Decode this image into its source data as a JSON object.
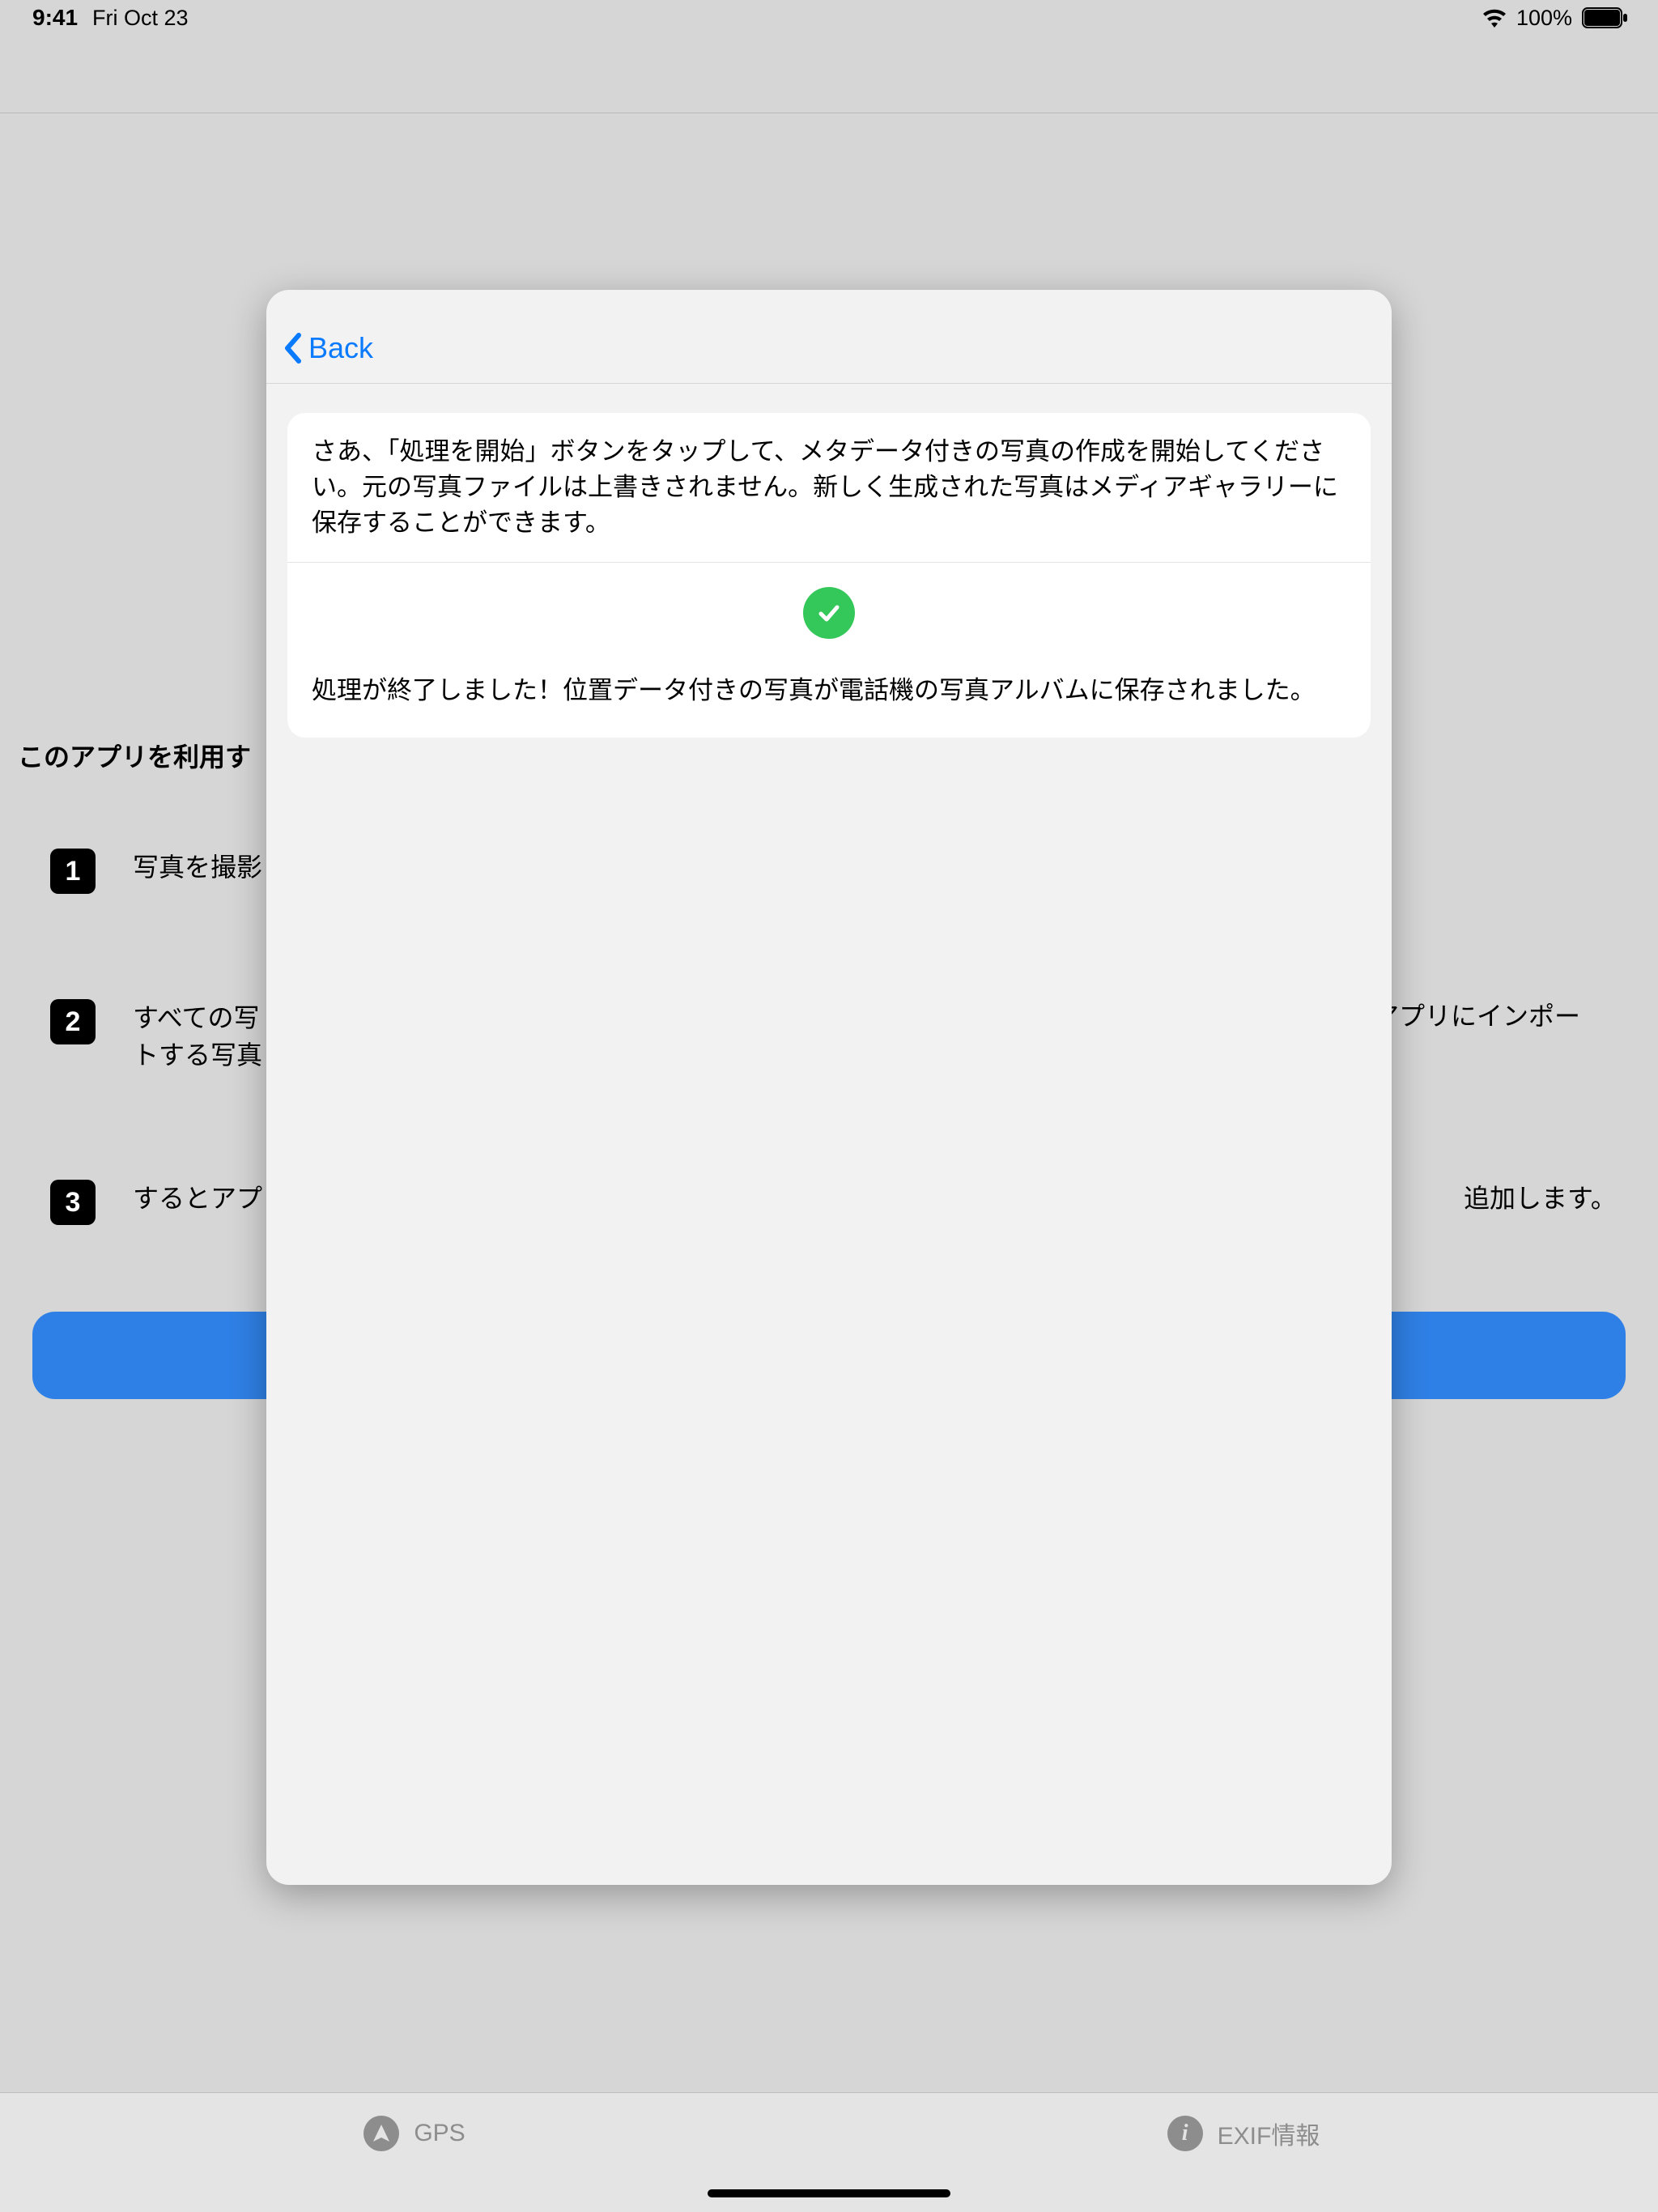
{
  "status_bar": {
    "time": "9:41",
    "date": "Fri Oct 23",
    "battery_pct": "100%"
  },
  "background": {
    "title": "このアプリを利用す",
    "steps": [
      {
        "num": "1",
        "left": "写真を撮影"
      },
      {
        "num": "2",
        "left": "すべての写\nトする写真",
        "right": "アプリにインポー"
      },
      {
        "num": "3",
        "left": "するとアプ",
        "right": "追加します。"
      }
    ]
  },
  "tab_bar": {
    "gps_label": "GPS",
    "exif_label": "EXIF情報"
  },
  "modal": {
    "back_label": "Back",
    "instruction": "さあ、「処理を開始」ボタンをタップして、メタデータ付きの写真の作成を開始してください。元の写真ファイルは上書きされません。新しく生成された写真はメディアギャラリーに保存することができます。",
    "result": "処理が終了しました！位置データ付きの写真が電話機の写真アルバムに保存されました。"
  }
}
